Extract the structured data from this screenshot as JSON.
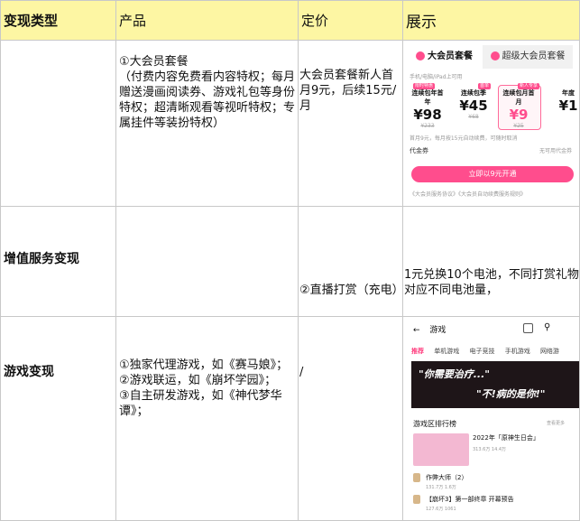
{
  "header": {
    "col1": "变现类型",
    "col2": "产品",
    "col3": "定价",
    "col4": "展示"
  },
  "rows": [
    {
      "type": "增值服务变现",
      "product": "①大会员套餐\n（付费内容免费看内容特权；每月赠送漫画阅读券、游戏礼包等身份特权；超清晰观看等视听特权；专属挂件等装扮特权）",
      "price": "大会员套餐新人首月9元，后续15元/月"
    },
    {
      "product2": "②直播打赏（充电）",
      "price2": "1元兑换10个电池，不同打赏礼物对应不同电池量，"
    },
    {
      "type": "游戏变现",
      "product": "①独家代理游戏，如《赛马娘》；\n②游戏联运，如《崩坏学园》；\n③自主研发游戏，如《神代梦华谭》；",
      "price": "/"
    }
  ],
  "membership": {
    "tab1": "大会员套餐",
    "tab2": "超级大会员套餐",
    "note": "手机/电脑/iPad上可用",
    "plans": [
      {
        "title": "连续包年首年",
        "price": "¥98",
        "orig": "¥233",
        "badge": "限时特惠"
      },
      {
        "title": "连续包季",
        "price": "¥45",
        "orig": "¥68",
        "badge": "首单"
      },
      {
        "title": "连续包月首月",
        "price": "¥9",
        "orig": "¥25",
        "badge": "新人专享"
      },
      {
        "title": "年度",
        "price": "¥1",
        "orig": ""
      }
    ],
    "renew": "首月9元，每月按15元自动续费，可随时取消",
    "coupon_label": "代金券",
    "coupon_value": "无可用代金券",
    "open_btn": "立即以9元开通",
    "agreement": "《大会员服务协议》《大会员自动续费服务规则》"
  },
  "game": {
    "back": "←",
    "title": "游戏",
    "tabs": [
      "推荐",
      "单机游戏",
      "电子竞技",
      "手机游戏",
      "网络游"
    ],
    "banner1": "\"你需要治疗...\"",
    "banner2": "\"不!病的是你!\"",
    "rank_title": "游戏区排行榜",
    "rank_more": "查看更多",
    "item1": "2022年「原神生日会」",
    "item1_stats": "313.6万  14.4万",
    "item2": "作弊大师（2）",
    "item2_stats": "131.7万  1.6万",
    "item3": "【崩坏3】第一部终章 开幕预告",
    "item3_stats": "127.6万  1061"
  },
  "colors": {
    "header_bg": "#fdf6a3",
    "pink": "#ff4d8d"
  }
}
